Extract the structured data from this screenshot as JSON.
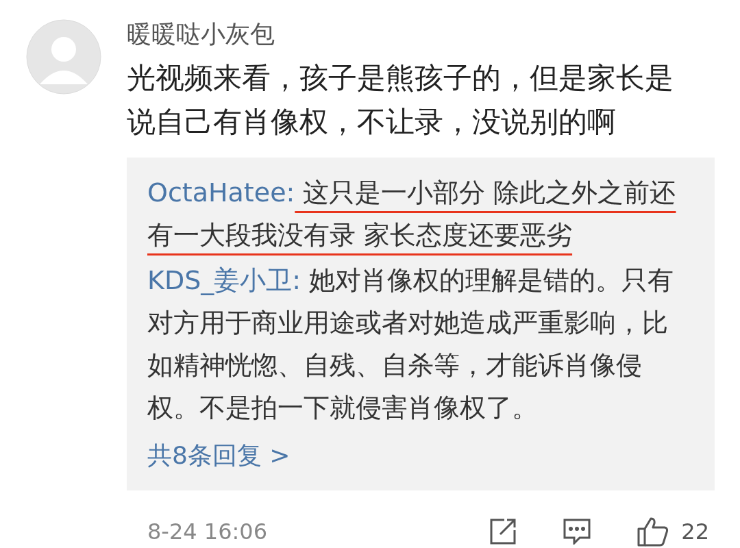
{
  "comment": {
    "username": "暖暖哒小灰包",
    "text": "光视频来看，孩子是熊孩子的，但是家长是说自己有肖像权，不让录，没说别的啊",
    "replies": [
      {
        "user": "OctaHatee:",
        "text": "这只是一小部分 除此之外之前还有一大段我没有录 家长态度还要恶劣",
        "underlined": true
      },
      {
        "user": "KDS_姜小卫:",
        "text": "她对肖像权的理解是错的。只有对方用于商业用途或者对她造成严重影响，比如精神恍惚、自残、自杀等，才能诉肖像侵权。不是拍一下就侵害肖像权了。",
        "underlined": false
      }
    ],
    "more_replies": "共8条回复 >",
    "time": "8-24 16:06",
    "like_count": "22"
  }
}
